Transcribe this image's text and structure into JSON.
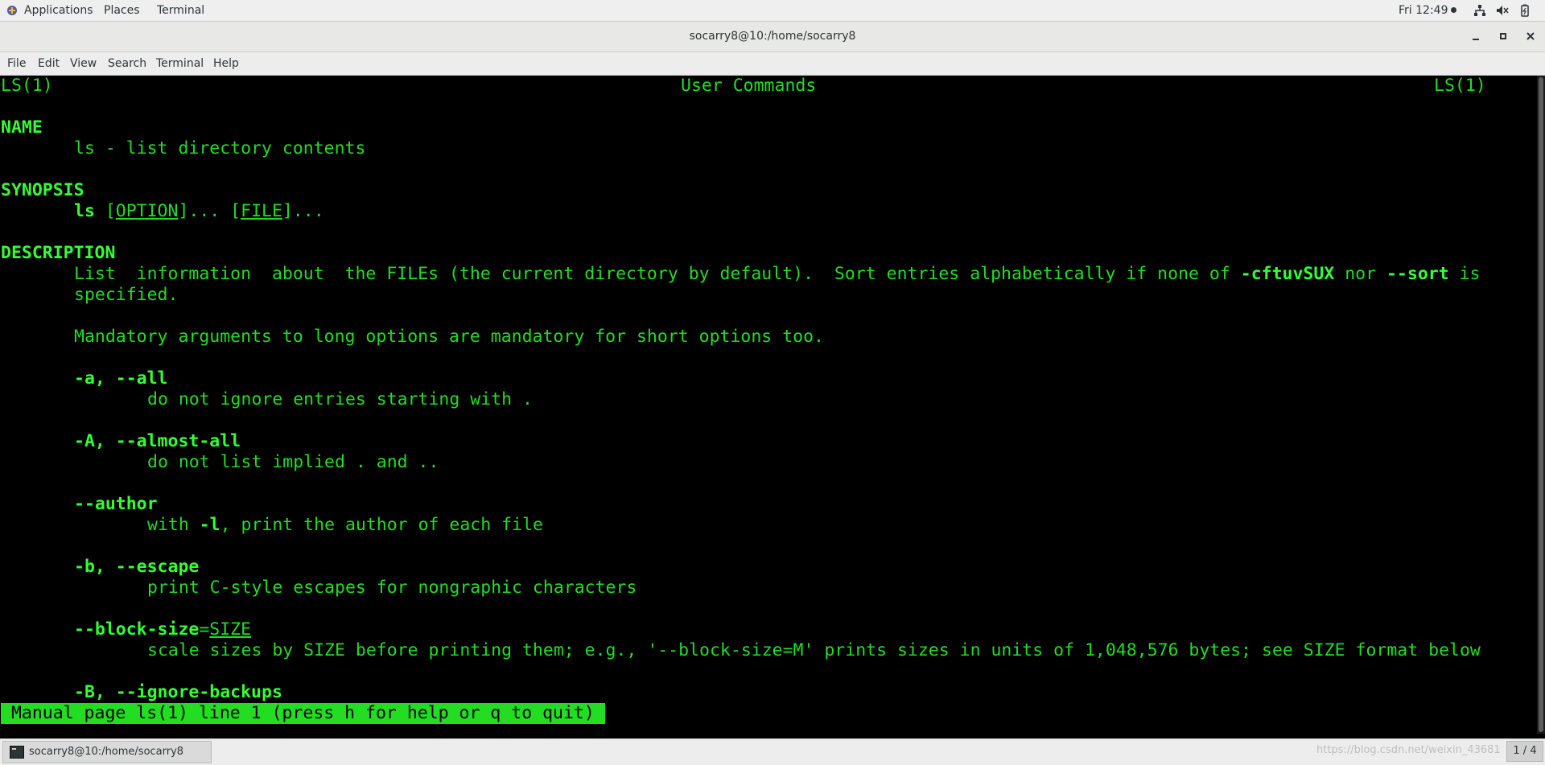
{
  "topbar": {
    "applications": "Applications",
    "places": "Places",
    "terminal": "Terminal",
    "clock": "Fri 12:49"
  },
  "window": {
    "title": "socarry8@10:/home/socarry8"
  },
  "menubar": [
    "File",
    "Edit",
    "View",
    "Search",
    "Terminal",
    "Help"
  ],
  "manpage": {
    "header_left": "LS(1)",
    "header_center": "User Commands",
    "header_right": "LS(1)",
    "section_name": "NAME",
    "name_line": "ls - list directory contents",
    "section_synopsis": "SYNOPSIS",
    "syn_cmd": "ls",
    "syn_option": "OPTION",
    "syn_file": "FILE",
    "section_description": "DESCRIPTION",
    "desc_1a": "List  information  about  the FILEs (the current directory by default).  Sort entries alphabetically if none of ",
    "desc_1_opt": "-cftuvSUX",
    "desc_1_nor": " nor ",
    "desc_1_sort": "--sort",
    "desc_1_is": " is",
    "desc_2": "specified.",
    "mandatory": "Mandatory arguments to long options are mandatory for short options too.",
    "opt_a": "-a, --all",
    "opt_a_desc": "do not ignore entries starting with .",
    "opt_A": "-A, --almost-all",
    "opt_A_desc": "do not list implied . and ..",
    "opt_author": "--author",
    "opt_author_with": "with ",
    "opt_author_l": "-l",
    "opt_author_rest": ", print the author of each file",
    "opt_b": "-b, --escape",
    "opt_b_desc": "print C-style escapes for nongraphic characters",
    "opt_bs": "--block-size",
    "opt_bs_arg": "SIZE",
    "opt_bs_desc": "scale sizes by SIZE before printing them; e.g., '--block-size=M' prints sizes in units of 1,048,576 bytes; see SIZE format below",
    "opt_B": "-B, --ignore-backups",
    "status_line": " Manual page ls(1) line 1 (press h for help or q to quit) "
  },
  "taskbar": {
    "task_label": "socarry8@10:/home/socarry8",
    "watermark": "https://blog.csdn.net/weixin_43681",
    "pager": "1 / 4"
  }
}
